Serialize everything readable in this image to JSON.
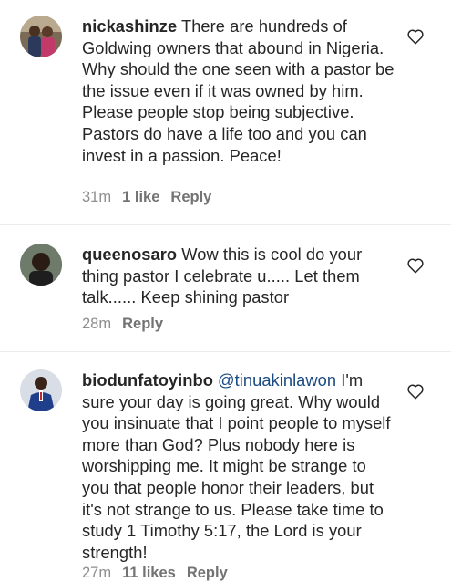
{
  "comments": [
    {
      "username": "nickashinze",
      "mention": "",
      "text": " There are hundreds of Goldwing owners that abound in Nigeria. Why should the one seen with a pastor be the issue even if it was owned by him. Please people stop being subjective. Pastors do have a life too and you can invest in a passion. Peace!",
      "time": "31m",
      "likes": "1 like",
      "reply": "Reply"
    },
    {
      "username": "queenosaro",
      "mention": "",
      "text": " Wow this is cool do your thing pastor I celebrate u..... Let them talk...... Keep shining  pastor",
      "time": "28m",
      "likes": "",
      "reply": "Reply"
    },
    {
      "username": "biodunfatoyinbo",
      "mention": " @tinuakinlawon",
      "text": " I'm sure your day is going great. Why would you insinuate that I point people to myself more than God? Plus nobody here is worshipping me. It might be strange to you that people honor their leaders, but it's not strange to us. Please take time to study 1 Timothy 5:17, the Lord is your strength!",
      "time": "27m",
      "likes": "11 likes",
      "reply": "Reply"
    }
  ],
  "icons": {
    "like": "heart-outline-icon"
  }
}
